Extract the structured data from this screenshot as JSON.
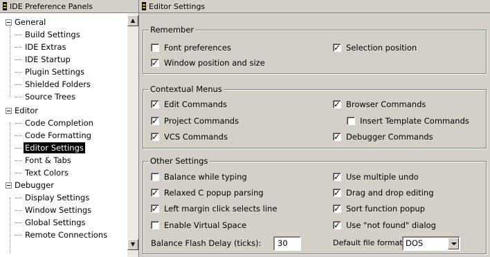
{
  "left_panel": {
    "title": "IDE Preference Panels",
    "tree": [
      {
        "label": "General",
        "children": [
          "Build Settings",
          "IDE Extras",
          "IDE Startup",
          "Plugin Settings",
          "Shielded Folders",
          "Source Trees"
        ]
      },
      {
        "label": "Editor",
        "children": [
          "Code Completion",
          "Code Formatting",
          "Editor Settings",
          "Font & Tabs",
          "Text Colors"
        ]
      },
      {
        "label": "Debugger",
        "children": [
          "Display Settings",
          "Window Settings",
          "Global Settings",
          "Remote Connections"
        ]
      }
    ],
    "selected": "Editor Settings"
  },
  "right_panel": {
    "title": "Editor Settings",
    "remember": {
      "title": "Remember",
      "font_preferences": {
        "label": "Font preferences",
        "checked": false
      },
      "selection_position": {
        "label": "Selection position",
        "checked": true
      },
      "window_position": {
        "label": "Window position and size",
        "checked": true
      }
    },
    "contextual_menus": {
      "title": "Contextual Menus",
      "edit_commands": {
        "label": "Edit Commands",
        "checked": true
      },
      "browser_commands": {
        "label": "Browser Commands",
        "checked": true
      },
      "project_commands": {
        "label": "Project Commands",
        "checked": true
      },
      "insert_template_commands": {
        "label": "Insert Template Commands",
        "checked": false
      },
      "vcs_commands": {
        "label": "VCS Commands",
        "checked": true
      },
      "debugger_commands": {
        "label": "Debugger Commands",
        "checked": true
      }
    },
    "other_settings": {
      "title": "Other Settings",
      "balance_while_typing": {
        "label": "Balance while typing",
        "checked": false
      },
      "use_multiple_undo": {
        "label": "Use multiple undo",
        "checked": true
      },
      "relaxed_c_popup": {
        "label": "Relaxed C popup parsing",
        "checked": true
      },
      "drag_and_drop": {
        "label": "Drag and drop editing",
        "checked": true
      },
      "left_margin_click": {
        "label": "Left margin click selects line",
        "checked": true
      },
      "sort_function_popup": {
        "label": "Sort function popup",
        "checked": true
      },
      "enable_virtual_space": {
        "label": "Enable Virtual Space",
        "checked": false
      },
      "use_not_found_dialog": {
        "label": "Use \"not found\" dialog",
        "checked": true
      },
      "balance_flash_delay_label": "Balance Flash Delay (ticks):",
      "balance_flash_delay_value": "30",
      "default_file_format_label": "Default file format:",
      "default_file_format_value": "DOS"
    }
  }
}
